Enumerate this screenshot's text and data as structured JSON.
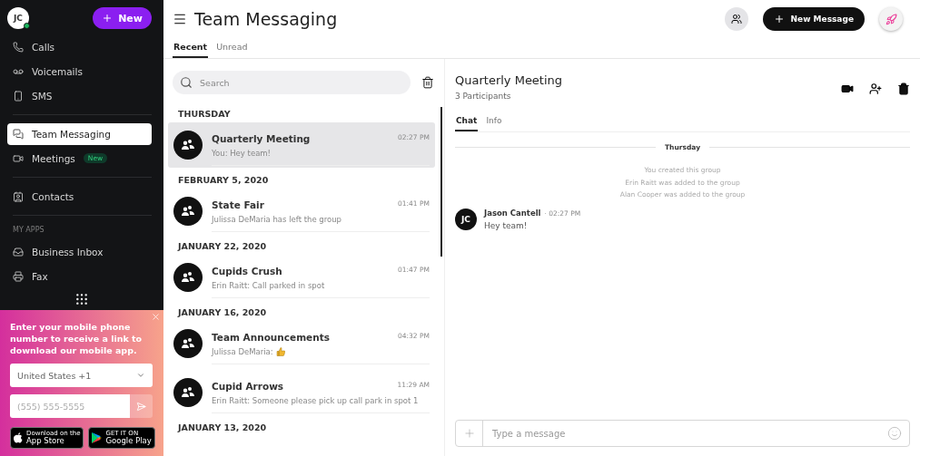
{
  "sidebar": {
    "avatar": "JC",
    "online": true,
    "new_button": "New",
    "nav_groups": [
      [
        {
          "label": "Calls",
          "selected": false
        },
        {
          "label": "Voicemails",
          "selected": false
        },
        {
          "label": "SMS",
          "selected": false
        }
      ],
      [
        {
          "label": "Team Messaging",
          "selected": true
        },
        {
          "label": "Meetings",
          "selected": false,
          "badge": "New"
        }
      ],
      [
        {
          "label": "Contacts",
          "selected": false
        }
      ]
    ],
    "section": "MY APPS",
    "apps": [
      {
        "label": "Business Inbox",
        "selected": false
      },
      {
        "label": "Fax",
        "selected": false
      }
    ]
  },
  "promo": {
    "text": "Enter your mobile phone number to receive a link to download our mobile app.",
    "country": "United States +1",
    "phone_placeholder": "(555) 555-5555",
    "stores": [
      {
        "small": "Download on the",
        "big": "App Store"
      },
      {
        "small": "GET IT ON",
        "big": "Google Play"
      }
    ]
  },
  "header": {
    "title": "Team Messaging",
    "new_message": "New Message"
  },
  "tabs": [
    {
      "label": "Recent",
      "selected": true
    },
    {
      "label": "Unread",
      "selected": false
    }
  ],
  "search": {
    "placeholder": "Search"
  },
  "conversations": [
    {
      "date": "THURSDAY",
      "items": [
        {
          "kind": "text",
          "title": "Quarterly Meeting",
          "time": "02:27 PM",
          "preview": "You: Hey team!",
          "selected": true
        }
      ]
    },
    {
      "date": "FEBRUARY 5, 2020",
      "items": [
        {
          "kind": "text",
          "title": "State Fair",
          "time": "01:41 PM",
          "preview": "Julissa DeMaria has left the group",
          "selected": false
        }
      ]
    },
    {
      "date": "JANUARY 22, 2020",
      "items": [
        {
          "kind": "text",
          "title": "Cupids Crush",
          "time": "01:47 PM",
          "preview": "Erin Raitt: Call parked in spot",
          "selected": false
        }
      ]
    },
    {
      "date": "JANUARY 16, 2020",
      "items": [
        {
          "kind": "thumbs",
          "title": "Team Announcements",
          "time": "04:32 PM",
          "preview": "Julissa DeMaria:",
          "selected": false
        },
        {
          "kind": "text",
          "title": "Cupid Arrows",
          "time": "11:29 AM",
          "preview": "Erin Raitt: Someone please pick up call park in spot 1",
          "selected": false
        }
      ]
    },
    {
      "date": "JANUARY 13, 2020"
    }
  ],
  "chat": {
    "title": "Quarterly Meeting",
    "subtitle": "3 Participants",
    "tabs": [
      {
        "label": "Chat",
        "selected": true
      },
      {
        "label": "Info",
        "selected": false
      }
    ],
    "day": "Thursday",
    "events": [
      "You created this group",
      "Erin Raitt was added to the group",
      "Alan Cooper was added to the group"
    ],
    "messages": [
      {
        "avatar": "JC",
        "author": "Jason Cantell",
        "time": "· 02:27 PM",
        "text": "Hey team!"
      }
    ],
    "input_placeholder": "Type a message"
  }
}
